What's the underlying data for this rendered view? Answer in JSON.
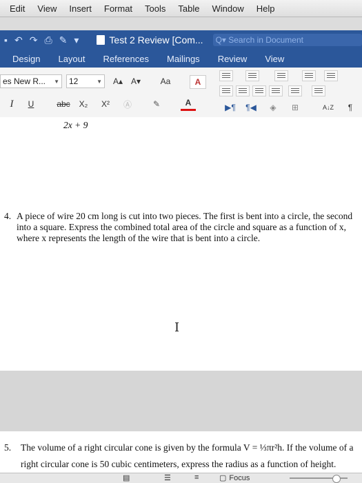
{
  "menubar": {
    "items": [
      "Edit",
      "View",
      "Insert",
      "Format",
      "Tools",
      "Table",
      "Window",
      "Help"
    ]
  },
  "titlebar": {
    "doc_title": "Test 2 Review [Com...",
    "search_placeholder": "Q▾ Search in Document"
  },
  "ribbon_tabs": [
    "Design",
    "Layout",
    "References",
    "Mailings",
    "Review",
    "View"
  ],
  "ribbon": {
    "font_name": "es New R...",
    "font_size": "12",
    "grow_font": "A▴",
    "shrink_font": "A▾",
    "change_case": "Aa",
    "italic": "I",
    "underline": "U",
    "strikethrough": "abc",
    "subscript": "X₂",
    "superscript": "X²",
    "font_color": "A",
    "pilcrow": "¶",
    "sort": "A↓Z"
  },
  "document": {
    "fragment": "2x + 9",
    "q4_number": "4.",
    "q4_line1": "A piece of wire 20 cm long is cut into two pieces. The first is bent into a circle, the second",
    "q4_line2": "into a square. Express the combined total area of the circle and square as a function of x,",
    "q4_line3": "where x represents the length of the wire that is bent into a circle.",
    "q5_number": "5.",
    "q5_line1": "The volume of a right circular cone is given by the formula V = ⅓πr²h. If the volume of a",
    "q5_line2": "right circular cone is 50 cubic centimeters, express the radius as a function of height."
  },
  "status": {
    "focus_label": "Focus"
  },
  "colors": {
    "word_blue": "#2b579a",
    "page": "#ffffff",
    "canvas_gray": "#d6d6d6"
  }
}
